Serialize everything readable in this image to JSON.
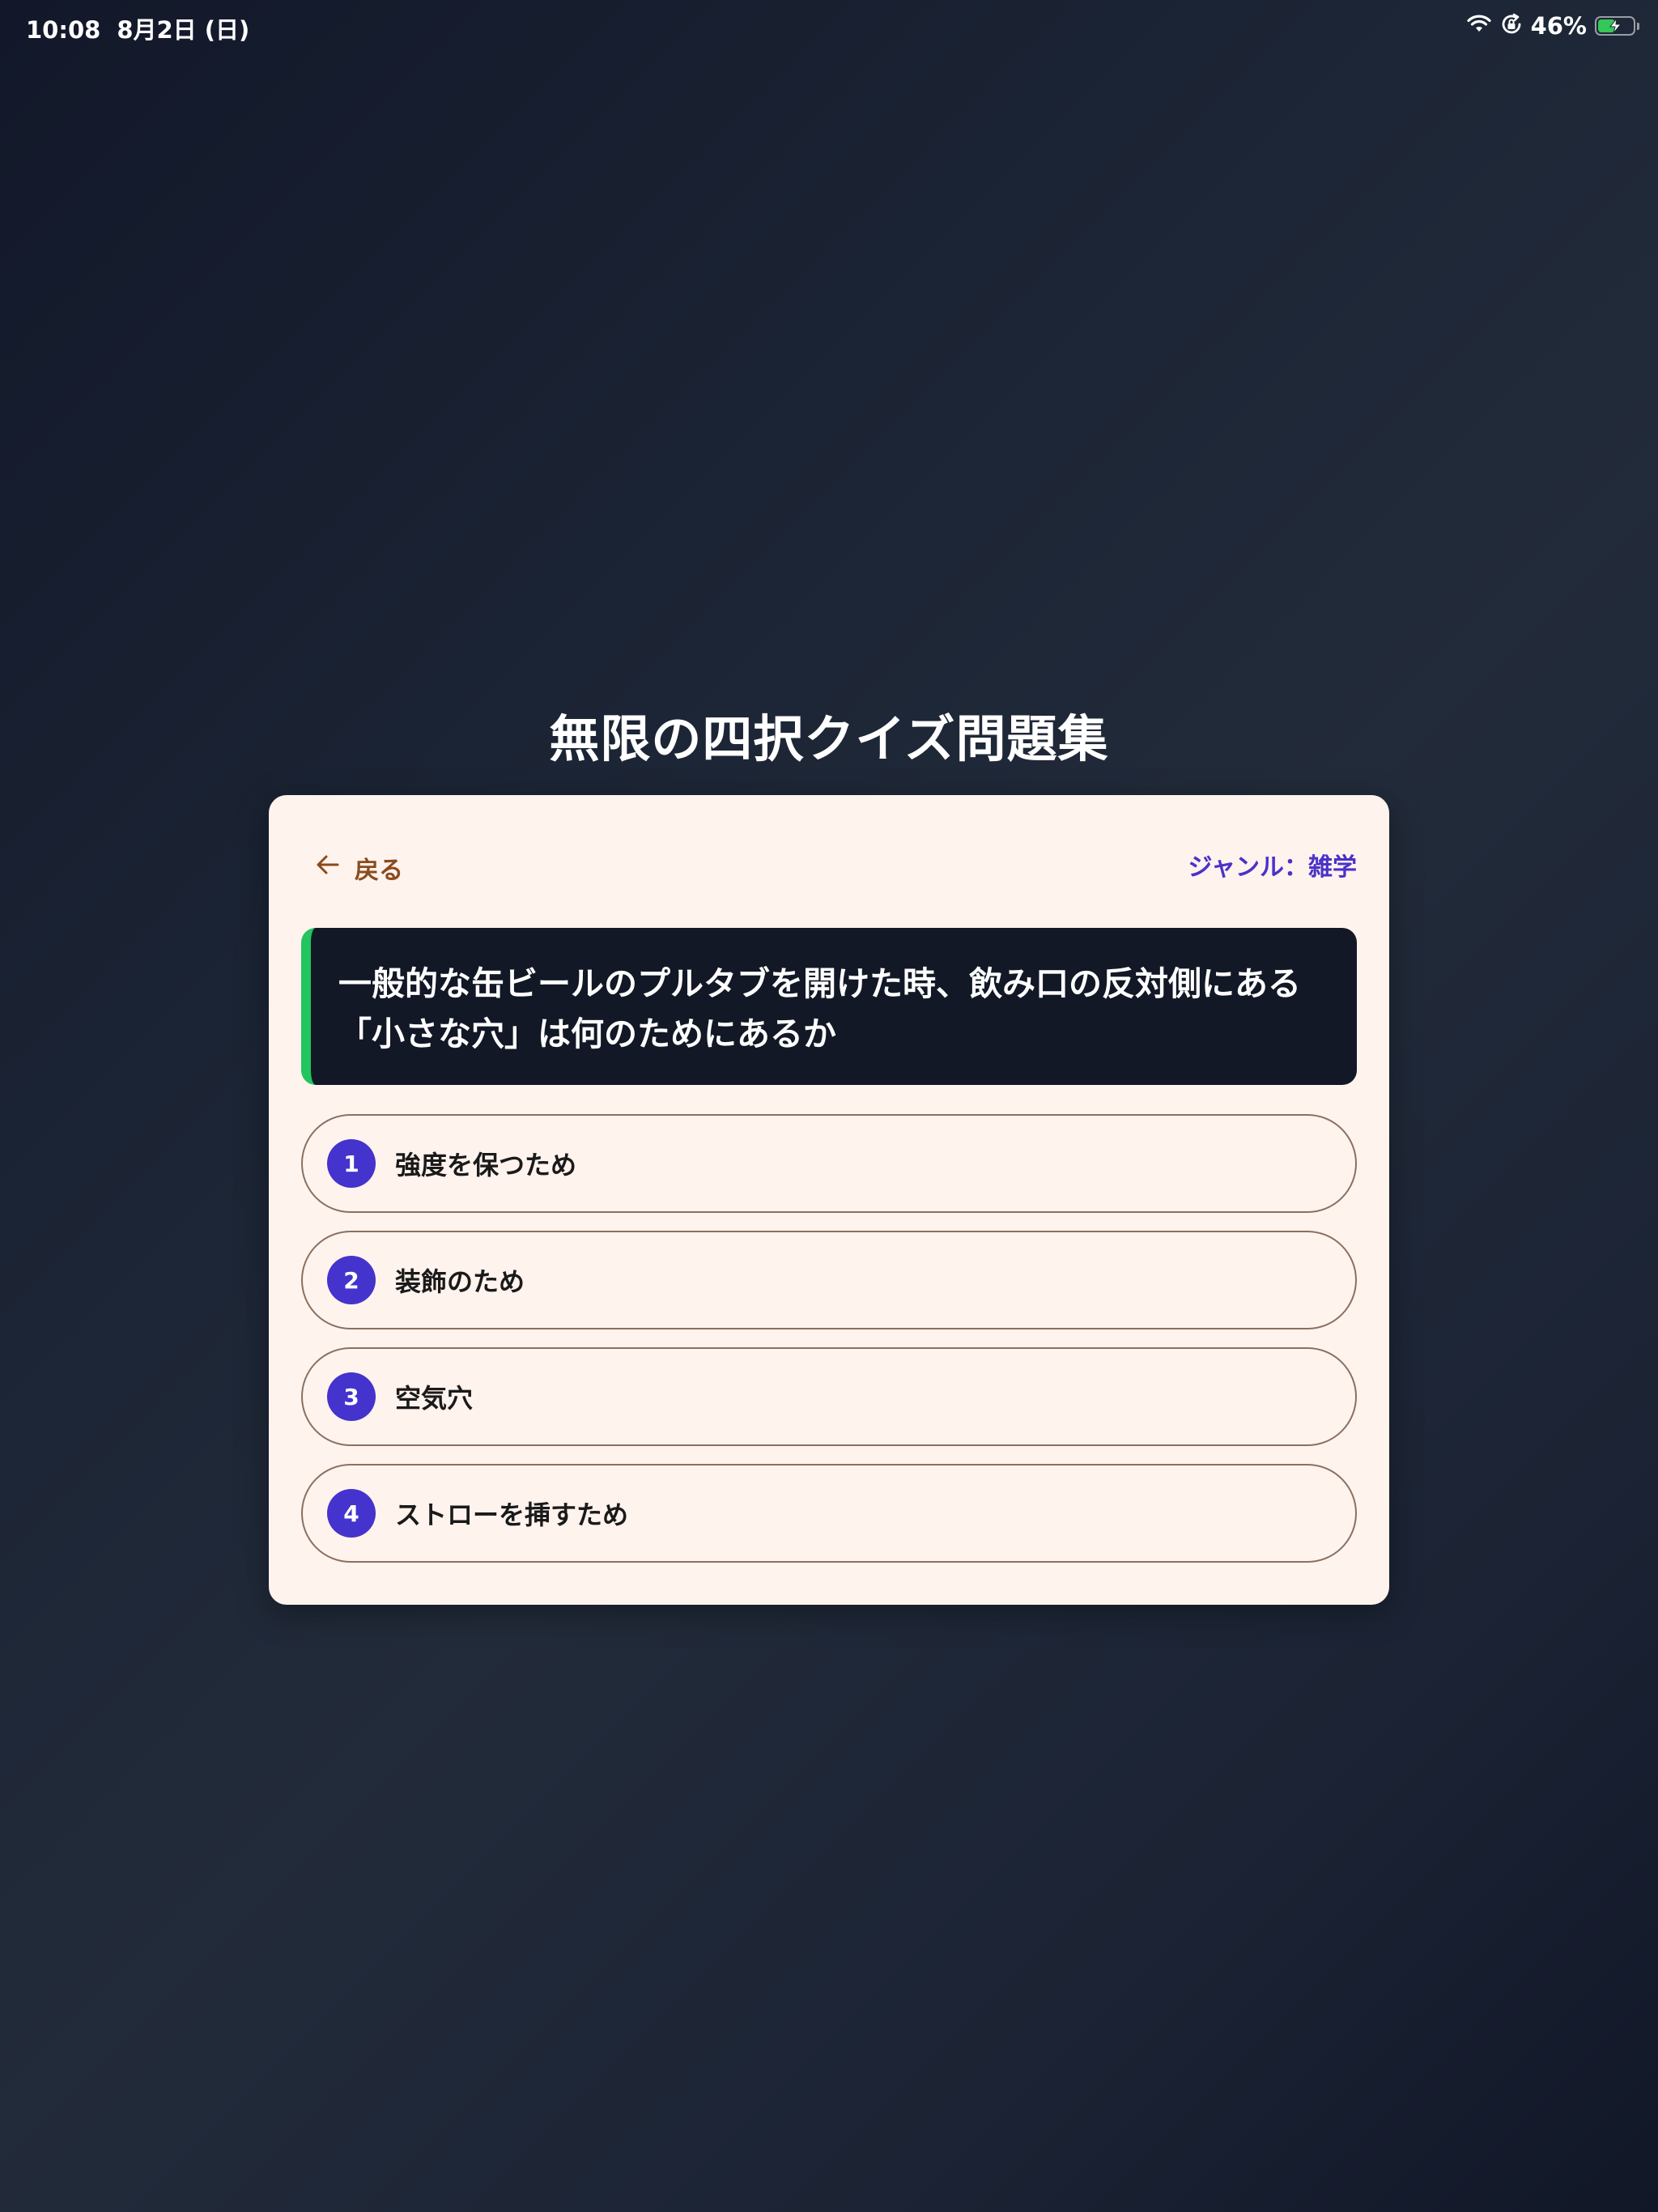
{
  "status_bar": {
    "time": "10:08",
    "date": "8月2日 (日)",
    "battery_percent": "46%",
    "battery_level": 0.46,
    "icons": [
      "wifi-icon",
      "orientation-lock-icon",
      "battery-charging-icon"
    ],
    "battery_color": "#34c759"
  },
  "page": {
    "title": "無限の四択クイズ問題集"
  },
  "card": {
    "back_label": "戻る",
    "genre_label": "ジャンル：雑学",
    "question": "一般的な缶ビールのプルタブを開けた時、飲み口の反対側にある「小さな穴」は何のためにあるか",
    "options": [
      {
        "number": "1",
        "label": "強度を保つため"
      },
      {
        "number": "2",
        "label": "装飾のため"
      },
      {
        "number": "3",
        "label": "空気穴"
      },
      {
        "number": "4",
        "label": "ストローを挿すため"
      }
    ]
  },
  "colors": {
    "accent_green": "#22c55e",
    "option_number_bg": "#4433cc",
    "genre_text": "#4a32c8",
    "back_text": "#8a4b1c",
    "card_bg": "#fff3ee",
    "question_bg": "#121826"
  }
}
